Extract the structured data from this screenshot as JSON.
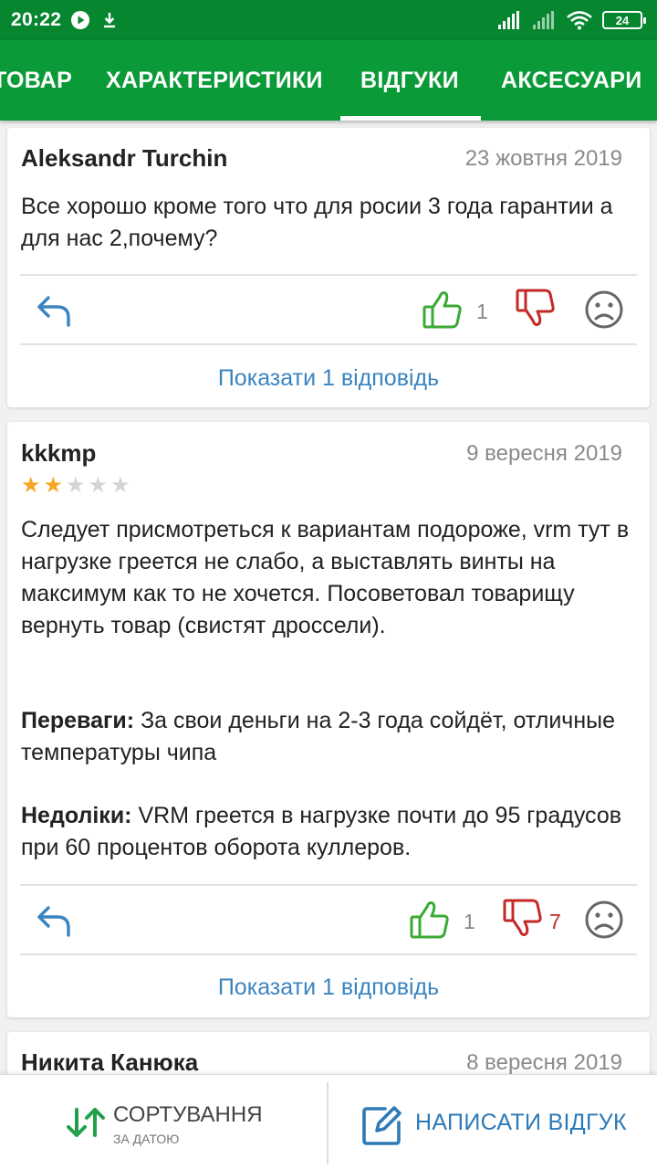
{
  "status_bar": {
    "time": "20:22",
    "battery": "24"
  },
  "tabs": [
    {
      "label": "ТОВАР"
    },
    {
      "label": "ХАРАКТЕРИСТИКИ"
    },
    {
      "label": "ВІДГУКИ"
    },
    {
      "label": "АКСЕСУАРИ"
    }
  ],
  "active_tab": "ВІДГУКИ",
  "reviews": [
    {
      "author": "Aleksandr Turchin",
      "date": "23 жовтня 2019",
      "text": "Все хорошо кроме того что для росии 3 года гарантии а для нас 2,почему?",
      "likes": "1",
      "show_replies": "Показати 1 відповідь"
    },
    {
      "author": "kkkmp",
      "date": "9 вересня 2019",
      "rating": 2,
      "rating_max": 5,
      "text": "Следует присмотреться к вариантам подороже, vrm тут в нагрузке греется не слабо, а выставлять винты на максимум как то не хочется. Посоветовал товарищу вернуть товар (свистят дроссели).",
      "pros_label": "Переваги:",
      "pros": "За свои деньги на 2-3 года сойдёт, отличные температуры чипа",
      "cons_label": "Недоліки:",
      "cons": "VRM греется в нагрузке почти до 95 градусов при 60 процентов оборота куллеров.",
      "likes": "1",
      "dislikes": "7",
      "show_replies": "Показати 1 відповідь"
    },
    {
      "author": "Никита Канюка",
      "date": "8 вересня 2019"
    }
  ],
  "bottom_bar": {
    "sort_label": "СОРТУВАННЯ",
    "sort_sub": "ЗА ДАТОЮ",
    "write_label": "НАПИСАТИ ВІДГУК"
  },
  "colors": {
    "status_bar": "#05862f",
    "tabs_bar": "#0a9a38",
    "like": "#3aaa35",
    "dislike": "#c62828",
    "link": "#3a84c0",
    "star": "#f5a623"
  },
  "icons": [
    "play-icon",
    "download-icon",
    "signal-icon",
    "wifi-icon",
    "battery-icon",
    "reply-icon",
    "thumbs-up-icon",
    "thumbs-down-icon",
    "sad-face-icon",
    "sort-arrows-icon",
    "edit-icon"
  ]
}
